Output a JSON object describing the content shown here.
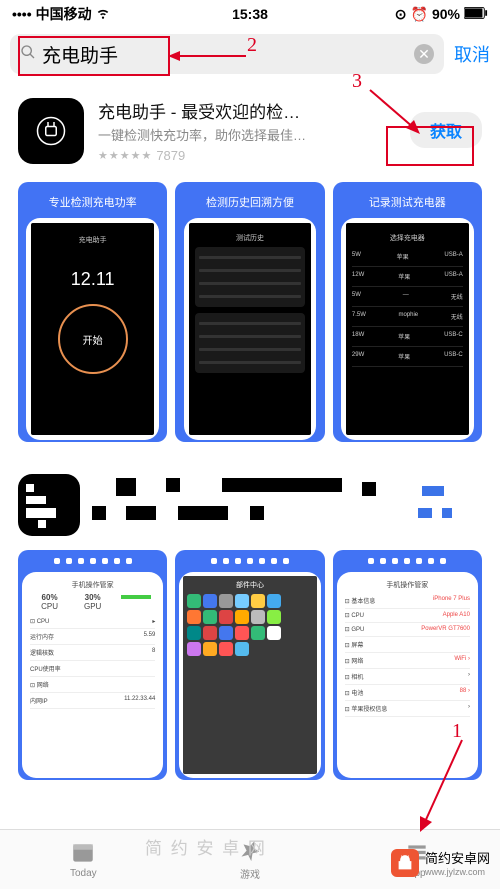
{
  "status": {
    "carrier": "中国移动",
    "time": "15:38",
    "battery": "90%"
  },
  "search": {
    "value": "充电助手",
    "cancel": "取消"
  },
  "app1": {
    "title": "充电助手 - 最受欢迎的检…",
    "subtitle": "一键检测快充功率，助你选择最佳…",
    "ratings": "7879",
    "get": "获取",
    "shots": [
      "专业检测充电功率",
      "检测历史回溯方便",
      "记录测试充电器"
    ],
    "p1": {
      "value": "12.11",
      "start": "开始"
    }
  },
  "app2": {
    "list_title": "手机操作管家",
    "stats": {
      "cpu": "60%",
      "gpu": "30%",
      "cpu_label": "CPU",
      "gpu_label": "GPU"
    }
  },
  "tabs": {
    "today": "Today",
    "games": "游戏",
    "apps": "App"
  },
  "annotations": {
    "n1": "1",
    "n2": "2",
    "n3": "3"
  },
  "watermark": {
    "text": "简 约 安 卓 网",
    "brand": "简约安卓网",
    "url": "www.jylzw.com"
  }
}
